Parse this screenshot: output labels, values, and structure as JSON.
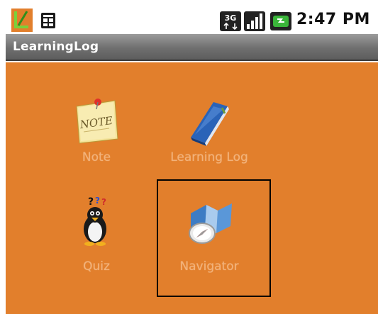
{
  "status_bar": {
    "time": "2:47 PM",
    "icons": [
      "app-icon",
      "notification-icon",
      "3g-icon",
      "signal-icon",
      "battery-icon"
    ],
    "network_label": "3G"
  },
  "title_bar": {
    "title": "LearningLog"
  },
  "launcher": {
    "items": [
      {
        "id": "note",
        "label": "Note",
        "icon": "note-icon"
      },
      {
        "id": "learninglog",
        "label": "Learning Log",
        "icon": "book-icon"
      },
      {
        "id": "quiz",
        "label": "Quiz",
        "icon": "penguin-quiz-icon"
      },
      {
        "id": "navigator",
        "label": "Navigator",
        "icon": "map-compass-icon",
        "selected": true
      }
    ]
  },
  "colors": {
    "background": "#e27f2c",
    "label": "#f2b27a",
    "title_bar": "#6f6f6f"
  }
}
